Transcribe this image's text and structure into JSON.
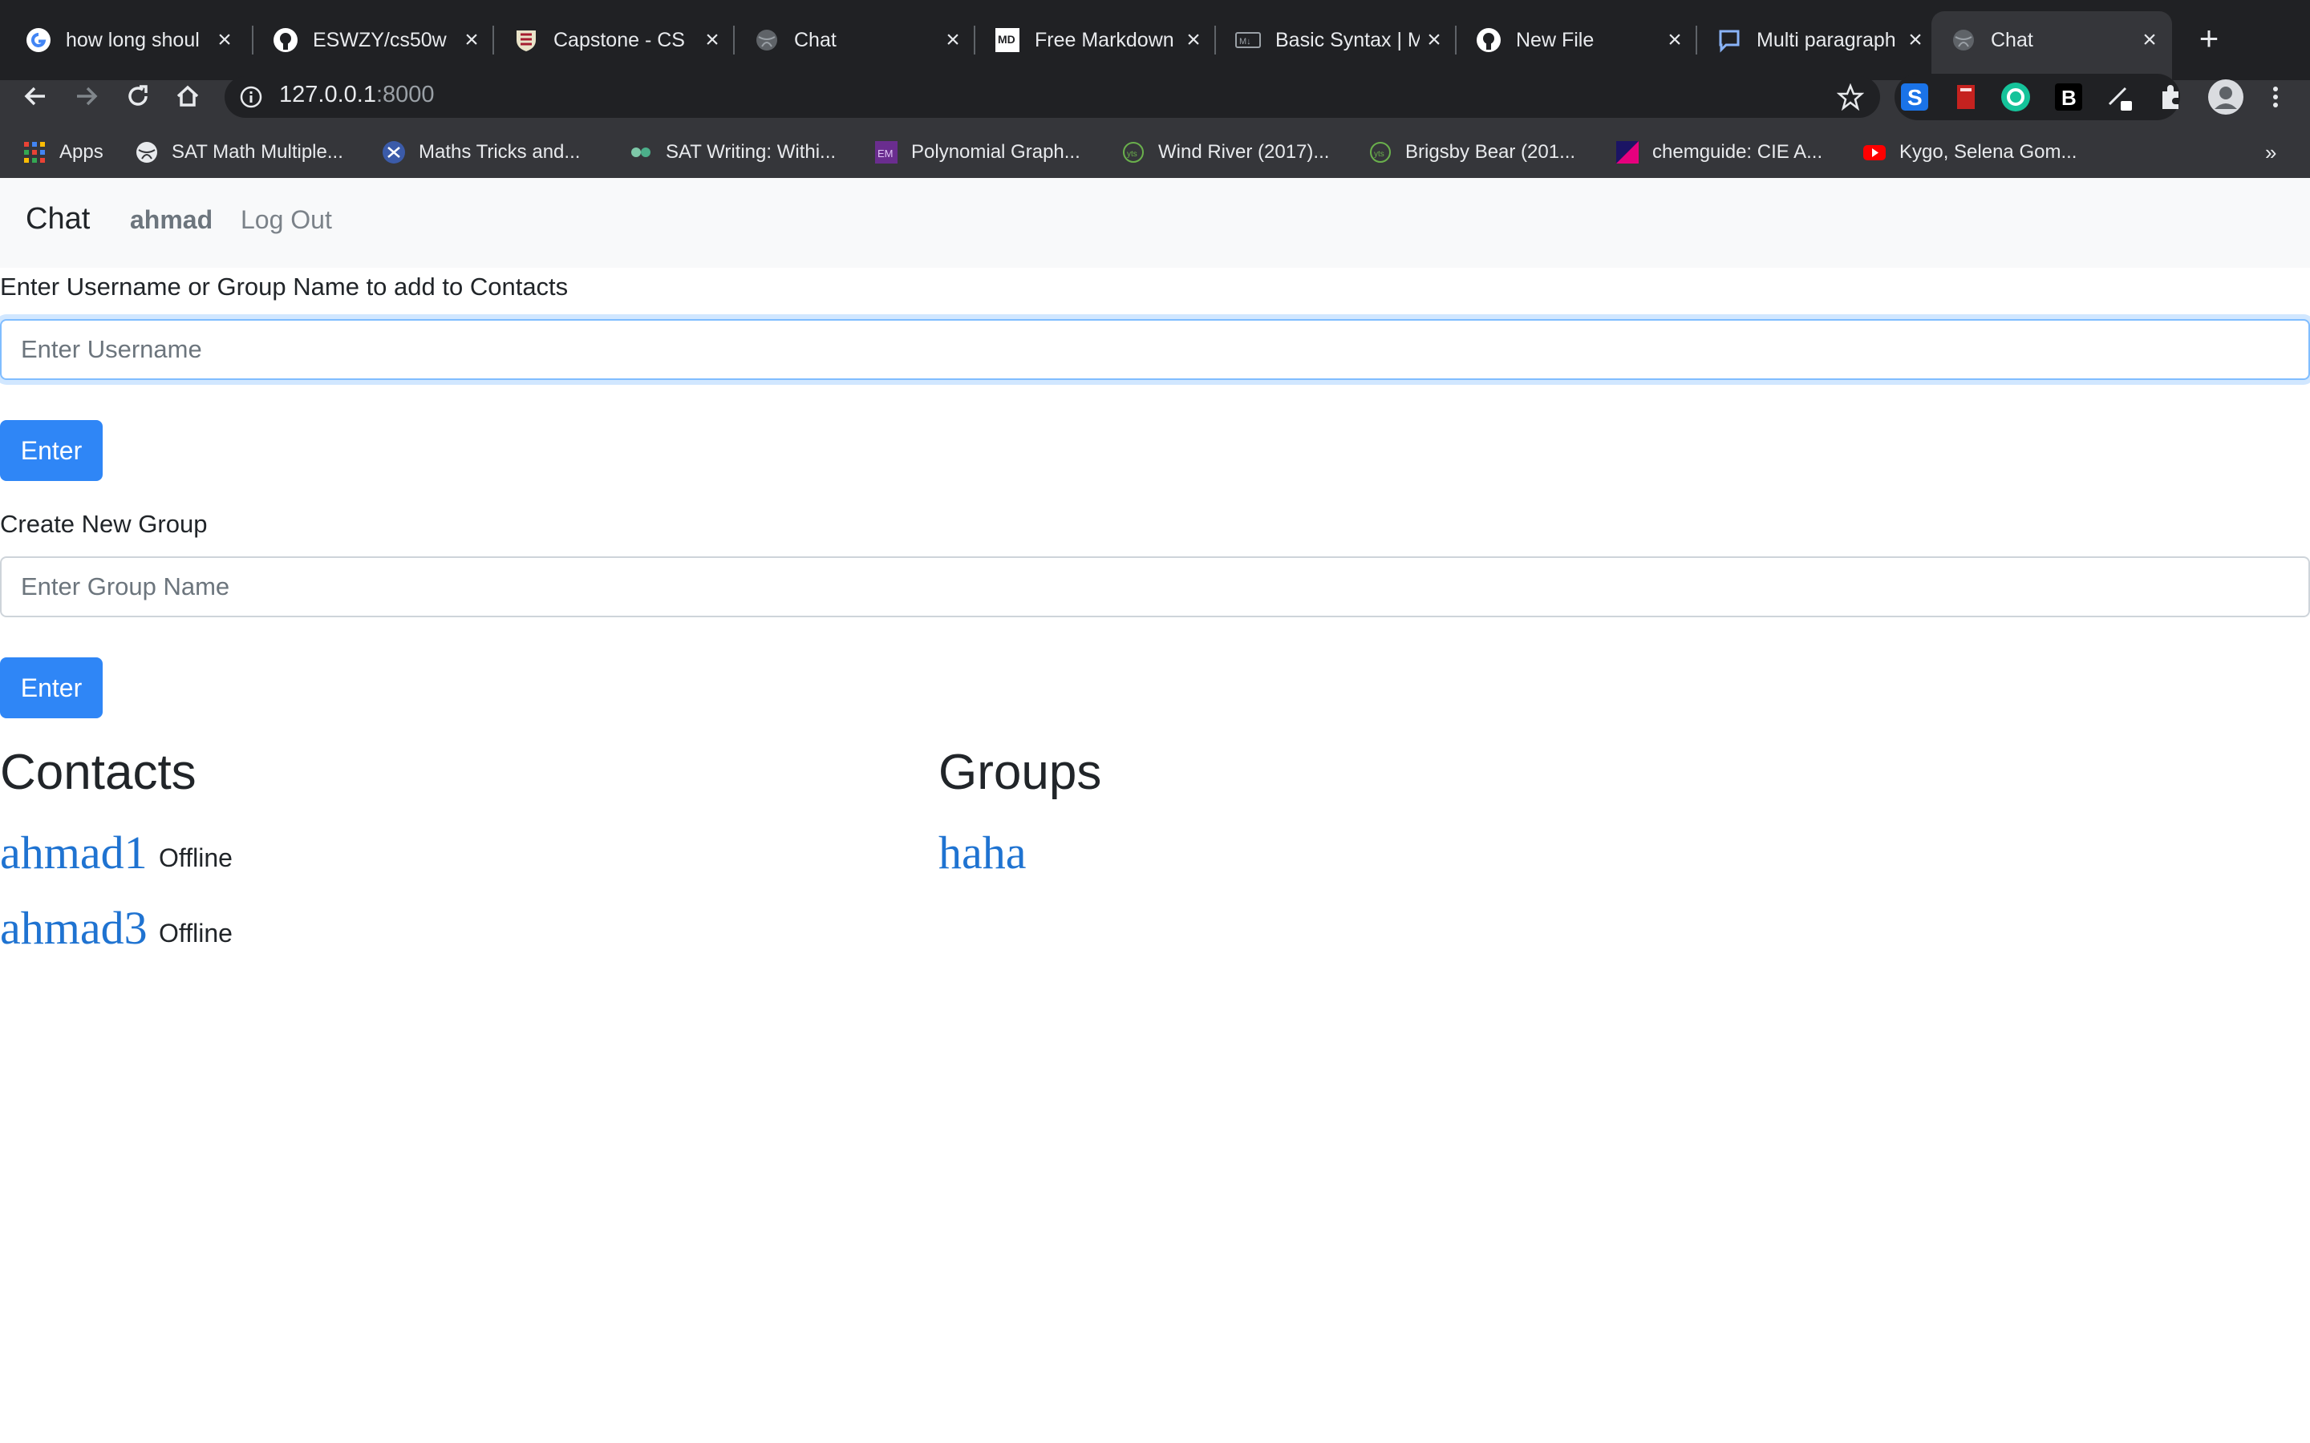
{
  "browser": {
    "tabs": [
      {
        "title": "how long shoul",
        "icon": "google-icon"
      },
      {
        "title": "ESWZY/cs50w",
        "icon": "github-icon"
      },
      {
        "title": "Capstone - CS",
        "icon": "harvard-shield-icon"
      },
      {
        "title": "Chat",
        "icon": "globe-icon"
      },
      {
        "title": "Free Markdown",
        "icon": "markdown-icon"
      },
      {
        "title": "Basic Syntax | M",
        "icon": "markdown-guide-icon"
      },
      {
        "title": "New File",
        "icon": "github-icon"
      },
      {
        "title": "Multi paragraph",
        "icon": "comment-icon"
      },
      {
        "title": "Chat",
        "icon": "globe-icon",
        "active": true
      }
    ],
    "address": {
      "host": "127.0.0.1",
      "port": ":8000"
    },
    "bookmarks": [
      {
        "label": "Apps",
        "icon": "apps-grid-icon"
      },
      {
        "label": "SAT Math Multiple...",
        "icon": "globe-icon"
      },
      {
        "label": "Maths Tricks and...",
        "icon": "maths-tricks-icon"
      },
      {
        "label": "SAT Writing: Withi...",
        "icon": "sat-writing-icon"
      },
      {
        "label": "Polynomial Graph...",
        "icon": "polynomial-icon"
      },
      {
        "label": "Wind River (2017)...",
        "icon": "yts-icon"
      },
      {
        "label": "Brigsby Bear (201...",
        "icon": "yts-icon"
      },
      {
        "label": "chemguide: CIE A...",
        "icon": "chemguide-icon"
      },
      {
        "label": "Kygo, Selena Gom...",
        "icon": "youtube-icon"
      }
    ],
    "overflow": "»"
  },
  "navbar": {
    "brand": "Chat",
    "user": "ahmad",
    "logout": "Log Out"
  },
  "add_contact": {
    "label": "Enter Username or Group Name to add to Contacts",
    "placeholder": "Enter Username",
    "button": "Enter"
  },
  "create_group": {
    "label": "Create New Group",
    "placeholder": "Enter Group Name",
    "button": "Enter"
  },
  "contacts": {
    "heading": "Contacts",
    "items": [
      {
        "name": "ahmad1",
        "status": "Offline"
      },
      {
        "name": "ahmad3",
        "status": "Offline"
      }
    ]
  },
  "groups": {
    "heading": "Groups",
    "items": [
      {
        "name": "haha"
      }
    ]
  }
}
